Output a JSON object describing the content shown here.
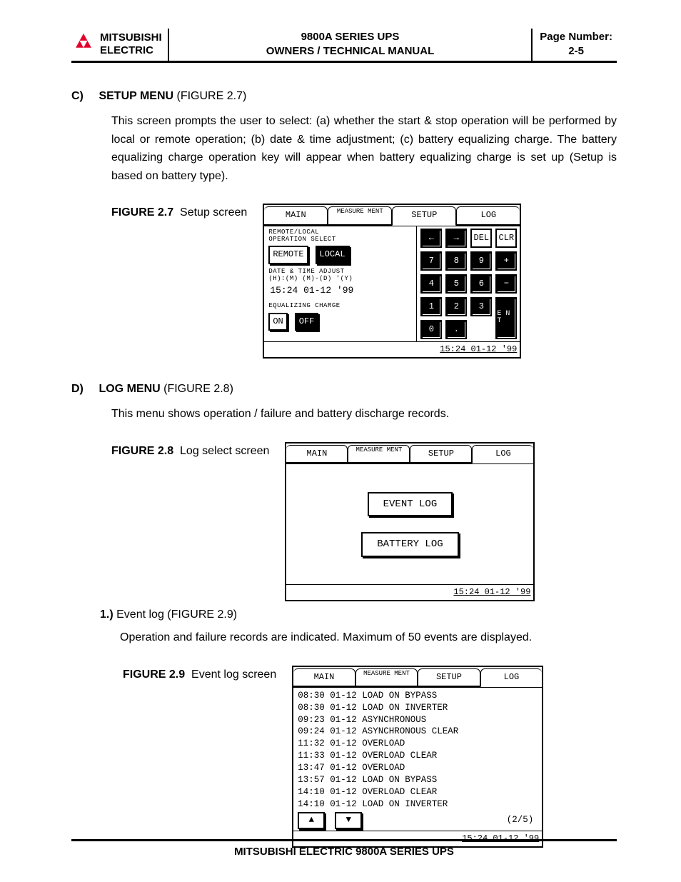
{
  "header": {
    "brand1": "MITSUBISHI",
    "brand2": "ELECTRIC",
    "title1": "9800A SERIES UPS",
    "title2": "OWNERS / TECHNICAL MANUAL",
    "pageLabel": "Page Number:",
    "pageNum": "2-5"
  },
  "sectionC": {
    "letter": "C)",
    "title": "SETUP MENU",
    "suffix": " (FIGURE 2.7)",
    "para": "This screen prompts the user to select: (a) whether the start & stop operation will be performed by local or remote operation; (b) date & time adjustment; (c) battery equalizing charge. The battery equalizing charge operation key will appear when battery equalizing charge is set up (Setup is based on battery type)."
  },
  "fig27": {
    "label": "FIGURE 2.7",
    "caption": "Setup   screen",
    "tabs": {
      "main": "MAIN",
      "meas": "MEASURE MENT",
      "setup": "SETUP",
      "log": "LOG"
    },
    "left": {
      "l1": "REMOTE/LOCAL",
      "l2": "OPERATION SELECT",
      "remote": "REMOTE",
      "local": "LOCAL",
      "dtl1": "DATE & TIME ADJUST",
      "dtl2": "(H):(M) (M)-(D)  '(Y)",
      "dtval": "15:24  01-12  '99",
      "eq": "EQUALIZING CHARGE",
      "on": "ON",
      "off": "OFF"
    },
    "keys": [
      "←",
      "→",
      "DEL",
      "CLR",
      "7",
      "8",
      "9",
      "+",
      "4",
      "5",
      "6",
      "−",
      "1",
      "2",
      "3",
      "E N T",
      "0",
      ".",
      "",
      ""
    ],
    "status": "15:24 01-12 '99"
  },
  "sectionD": {
    "letter": "D)",
    "title": "LOG MENU",
    "suffix": " (FIGURE 2.8)",
    "para": "This menu shows operation / failure and battery discharge records."
  },
  "fig28": {
    "label": "FIGURE 2.8",
    "caption": "Log select screen",
    "event": "EVENT LOG",
    "battery": "BATTERY LOG",
    "status": "15:24 01-12 '99"
  },
  "sub1": {
    "num": "1.)",
    "title": "Event log (FIGURE 2.9)",
    "para": "Operation and failure records are indicated. Maximum of 50 events are displayed."
  },
  "fig29": {
    "label": "FIGURE 2.9",
    "caption": "Event log screen",
    "rows": [
      "08:30 01-12 LOAD ON BYPASS",
      "08:30 01-12 LOAD ON INVERTER",
      "09:23 01-12 ASYNCHRONOUS",
      "09:24 01-12 ASYNCHRONOUS CLEAR",
      "11:32 01-12 OVERLOAD",
      "11:33 01-12 OVERLOAD CLEAR",
      "13:47 01-12 OVERLOAD",
      "13:57 01-12 LOAD ON BYPASS",
      "14:10 01-12 OVERLOAD CLEAR",
      "14:10 01-12 LOAD ON INVERTER"
    ],
    "page": "(2/5)",
    "status": "15:24 01-12 '99"
  },
  "footer": "MITSUBISHI ELECTRIC 9800A SERIES UPS"
}
